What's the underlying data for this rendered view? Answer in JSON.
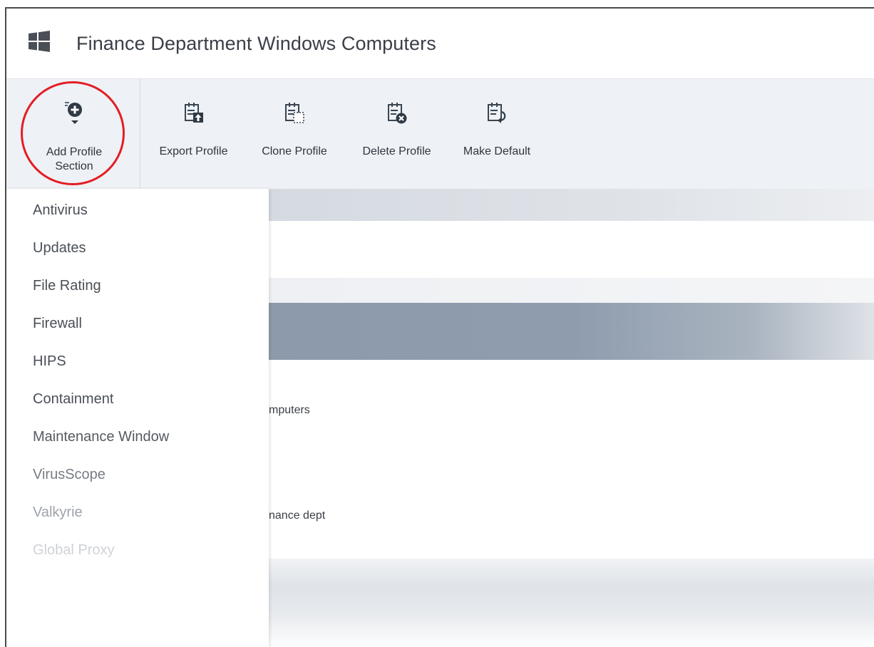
{
  "header": {
    "title": "Finance Department Windows Computers",
    "logo_icon": "windows-logo-icon"
  },
  "toolbar": {
    "add_section": {
      "label": "Add Profile Section",
      "icon": "add-section-icon",
      "highlight_color": "#e31d24"
    },
    "export": {
      "label": "Export Profile",
      "icon": "export-icon"
    },
    "clone": {
      "label": "Clone Profile",
      "icon": "clone-icon"
    },
    "delete": {
      "label": "Delete Profile",
      "icon": "delete-icon"
    },
    "make_default": {
      "label": "Make Default",
      "icon": "make-default-icon"
    }
  },
  "menu": {
    "items": [
      {
        "label": "Antivirus"
      },
      {
        "label": "Updates"
      },
      {
        "label": "File Rating"
      },
      {
        "label": "Firewall"
      },
      {
        "label": "HIPS"
      },
      {
        "label": "Containment"
      },
      {
        "label": "Maintenance Window"
      },
      {
        "label": "VirusScope"
      },
      {
        "label": "Valkyrie"
      },
      {
        "label": "Global Proxy"
      }
    ]
  },
  "background": {
    "text_computers": "mputers",
    "text_finance": "nance dept"
  },
  "colors": {
    "accent_red": "#e31d24",
    "toolbar_bg": "#eef1f5",
    "header_band": "#8c9aab"
  }
}
